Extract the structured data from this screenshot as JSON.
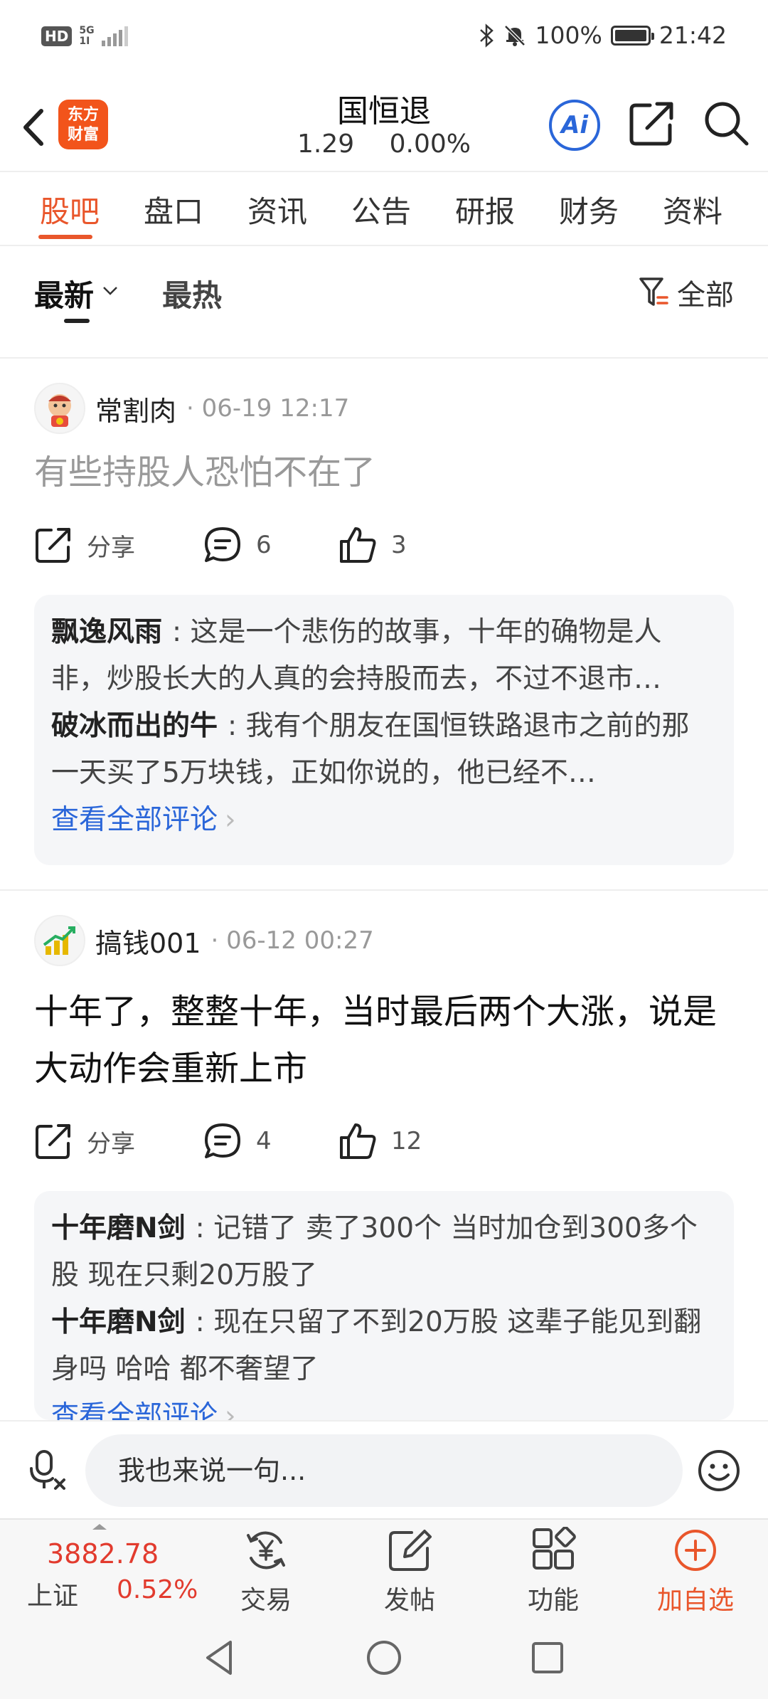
{
  "status_bar": {
    "left_badge": "HD",
    "signal_top": "5G",
    "signal_bottom": "1I",
    "battery": "100%",
    "time": "21:42"
  },
  "header": {
    "logo_line1": "东方",
    "logo_line2": "财富",
    "stock_name": "国恒退",
    "price": "1.29",
    "change": "0.00%",
    "ai_label": "Ai"
  },
  "tabs": [
    "股吧",
    "盘口",
    "资讯",
    "公告",
    "研报",
    "财务",
    "资料"
  ],
  "sort": {
    "newest": "最新",
    "hot": "最热",
    "filter_label": "全部"
  },
  "posts": [
    {
      "user": "常割肉",
      "time": "· 06-19 12:17",
      "content": "有些持股人恐怕不在了",
      "share_label": "分享",
      "comment_count": "6",
      "like_count": "3",
      "comments": [
        {
          "user": "飘逸风雨",
          "text": ": 这是一个悲伤的故事，十年的确物是人非，炒股长大的人真的会持股而去，不过不退市…"
        },
        {
          "user": "破冰而出的牛",
          "text": ": 我有个朋友在国恒铁路退市之前的那一天买了5万块钱，正如你说的，他已经不…"
        }
      ],
      "view_all": "查看全部评论"
    },
    {
      "user": "搞钱001",
      "time": "· 06-12 00:27",
      "content": "十年了，整整十年，当时最后两个大涨，说是大动作会重新上市",
      "share_label": "分享",
      "comment_count": "4",
      "like_count": "12",
      "comments": [
        {
          "user": "十年磨N剑",
          "text": ": 记错了 卖了300个 当时加仓到300多个股 现在只剩20万股了"
        },
        {
          "user": "十年磨N剑",
          "text": ": 现在只留了不到20万股 这辈子能见到翻身吗 哈哈 都不奢望了"
        }
      ],
      "view_all": "查看全部评论"
    }
  ],
  "input_bar": {
    "placeholder": "我也来说一句..."
  },
  "bottom_nav": {
    "index_value": "3882.78",
    "index_name": "上证",
    "index_change": "0.52%",
    "items": [
      {
        "label": "交易",
        "icon": "yuan-exchange-icon"
      },
      {
        "label": "发帖",
        "icon": "edit-post-icon"
      },
      {
        "label": "功能",
        "icon": "grid-icon"
      },
      {
        "label": "加自选",
        "icon": "add-circle-icon"
      }
    ]
  },
  "colors": {
    "accent": "#e9562b",
    "link": "#2a66d9",
    "up_red": "#e23b2e"
  }
}
